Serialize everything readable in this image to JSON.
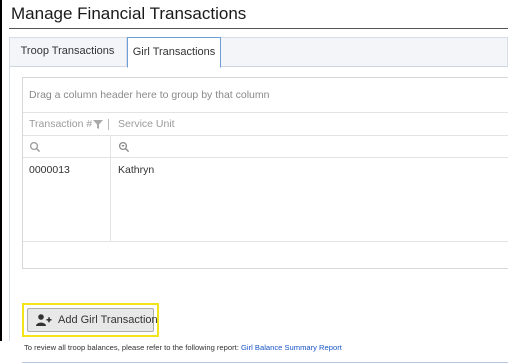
{
  "page": {
    "title": "Manage Financial Transactions"
  },
  "tabs": [
    {
      "label": "Troop Transactions",
      "selected": false
    },
    {
      "label": "Girl Transactions",
      "selected": true
    }
  ],
  "grid": {
    "group_panel_text": "Drag a column header here to group by that column",
    "columns": [
      "Transaction #",
      "Service Unit"
    ],
    "rows": [
      {
        "transaction_no": "0000013",
        "service_unit": "Kathryn"
      }
    ]
  },
  "actions": {
    "add_label": "Add Girl Transaction"
  },
  "footer": {
    "note": "To review all troop balances, please refer to the following report:",
    "report_link": "Girl Balance Summary Report"
  },
  "colors": {
    "highlight": "#f2e419",
    "link": "#1a56c9",
    "tab_active_border": "#6c9fd5"
  }
}
